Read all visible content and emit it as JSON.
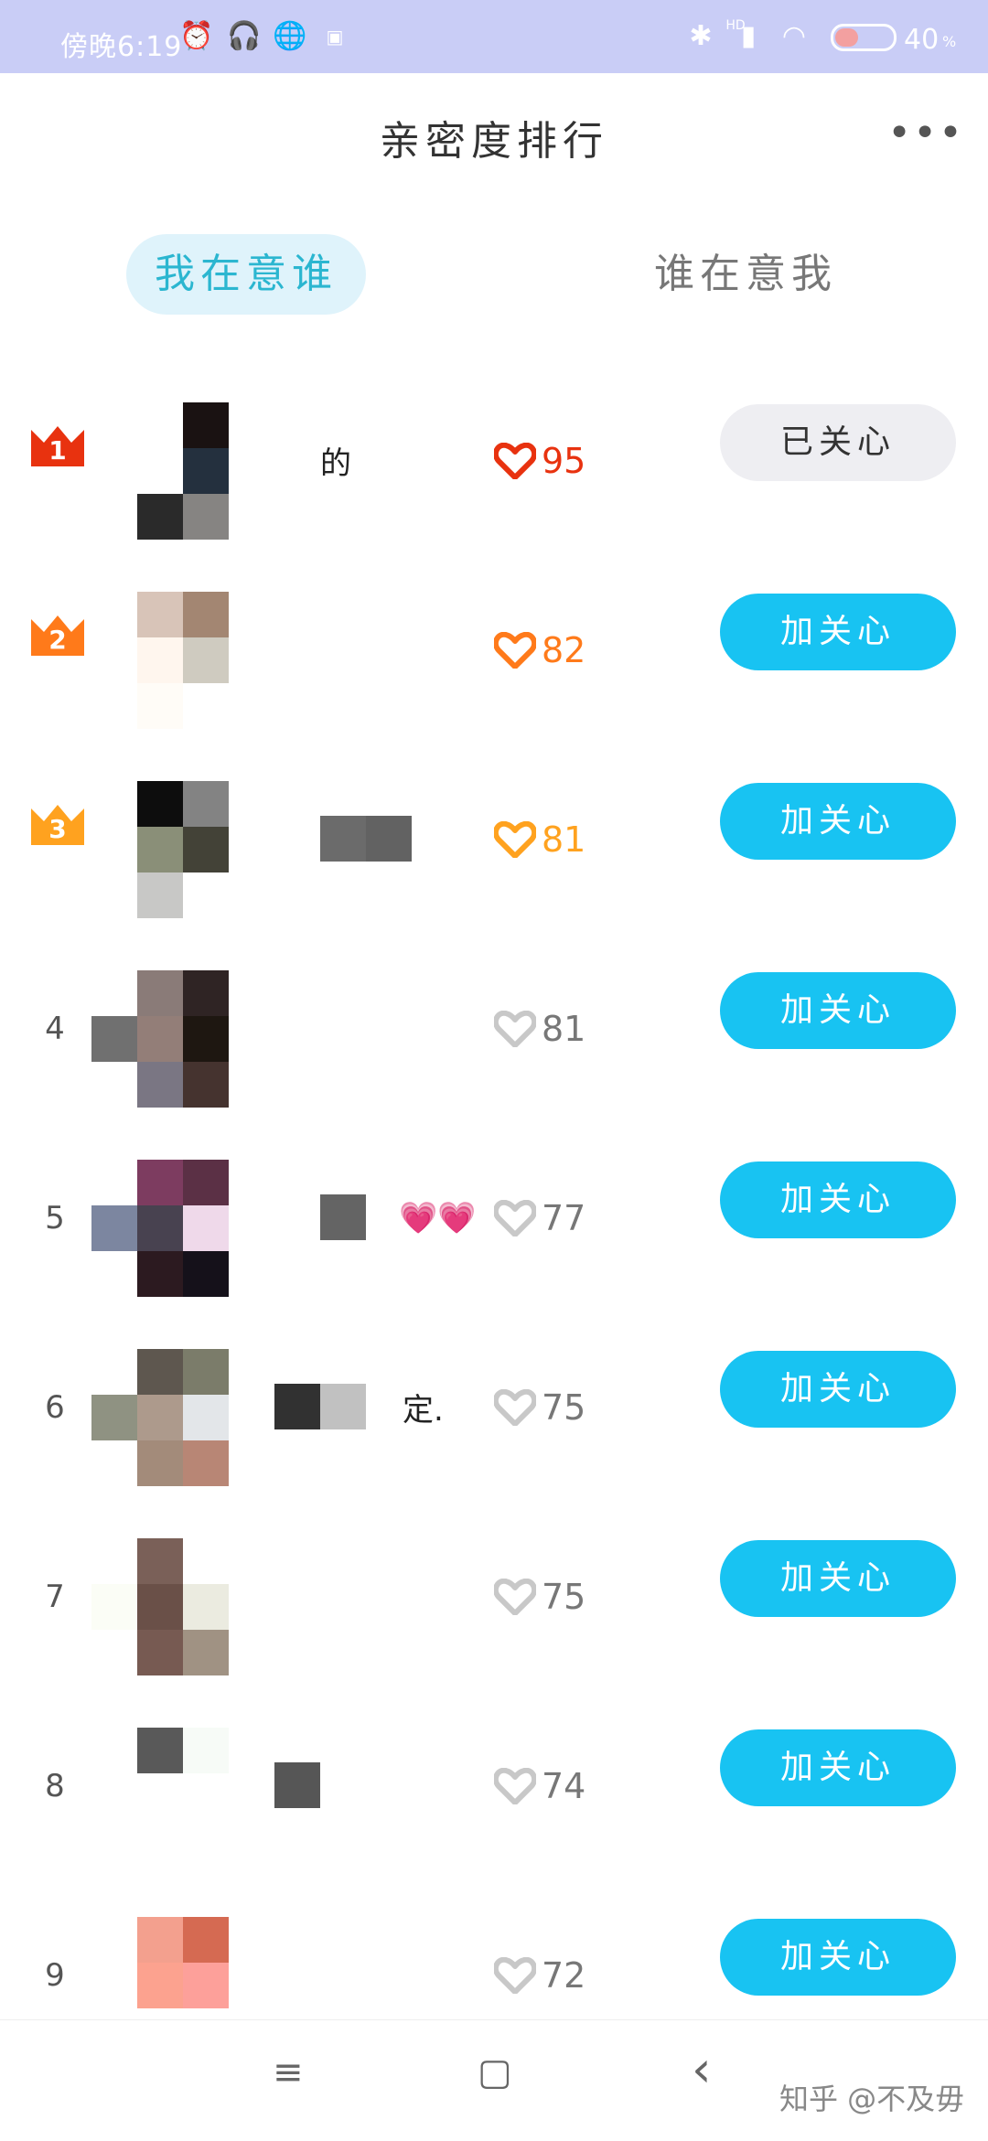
{
  "status_bar": {
    "time": "傍晚6:19",
    "network": "HD",
    "battery": "40",
    "battery_unit": "%",
    "battery_level": 0.4,
    "icons": [
      "alarm-icon",
      "headset-icon",
      "globe-icon",
      "app-icon",
      "bluetooth-icon",
      "signal-icon",
      "wifi-icon",
      "battery-icon"
    ]
  },
  "header": {
    "title": "亲密度排行",
    "more": "•••"
  },
  "tabs": [
    {
      "label": "我在意谁",
      "active": true
    },
    {
      "label": "谁在意我",
      "active": false
    }
  ],
  "colors": {
    "accent": "#18c3f2",
    "rank1": "#e8320f",
    "rank2": "#ff7a1a",
    "rank3": "#ffa21f",
    "heart_gray": "#c8c8c8"
  },
  "rows": [
    {
      "rank": "1",
      "name": "的",
      "score": "95",
      "button": "已关心"
    },
    {
      "rank": "2",
      "name": "",
      "score": "82",
      "button": "加关心"
    },
    {
      "rank": "3",
      "name": "",
      "score": "81",
      "button": "加关心"
    },
    {
      "rank": "4",
      "name": "",
      "score": "81",
      "button": "加关心"
    },
    {
      "rank": "5",
      "name": "💗💗",
      "score": "77",
      "button": "加关心"
    },
    {
      "rank": "6",
      "name": "定.",
      "score": "75",
      "button": "加关心"
    },
    {
      "rank": "7",
      "name": "",
      "score": "75",
      "button": "加关心"
    },
    {
      "rank": "8",
      "name": "",
      "score": "74",
      "button": "加关心"
    },
    {
      "rank": "9",
      "name": "",
      "score": "72",
      "button": "加关心"
    }
  ],
  "nav": {
    "menu": "≡",
    "home": "▢",
    "back": "‹"
  },
  "watermark": "知乎 @不及毋"
}
